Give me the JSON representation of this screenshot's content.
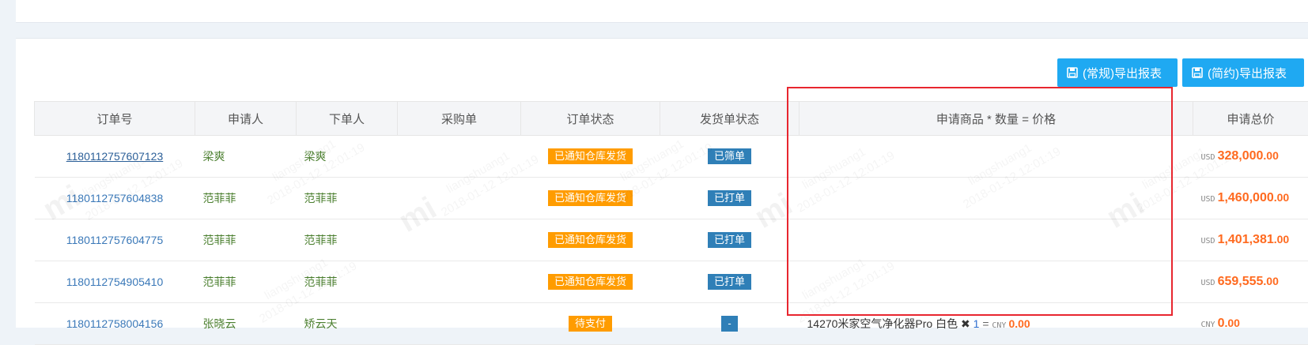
{
  "toolbar": {
    "export_normal_label": "(常规)导出报表",
    "export_simple_label": "(简约)导出报表"
  },
  "table": {
    "headers": [
      "订单号",
      "申请人",
      "下单人",
      "采购单",
      "订单状态",
      "发货单状态",
      "申请商品 * 数量 = 价格",
      "申请总价"
    ],
    "rows": [
      {
        "order_id": "1180112757607123",
        "applicant": "梁爽",
        "orderer": "梁爽",
        "purchase": "",
        "order_status": "已通知仓库发货",
        "ship_status": "已筛单",
        "goods": "",
        "currency": "USD",
        "total_int": "328,000",
        "total_dec": ".00"
      },
      {
        "order_id": "1180112757604838",
        "applicant": "范菲菲",
        "orderer": "范菲菲",
        "purchase": "",
        "order_status": "已通知仓库发货",
        "ship_status": "已打单",
        "goods": "",
        "currency": "USD",
        "total_int": "1,460,000",
        "total_dec": ".00"
      },
      {
        "order_id": "1180112757604775",
        "applicant": "范菲菲",
        "orderer": "范菲菲",
        "purchase": "",
        "order_status": "已通知仓库发货",
        "ship_status": "已打单",
        "goods": "",
        "currency": "USD",
        "total_int": "1,401,381",
        "total_dec": ".00"
      },
      {
        "order_id": "1180112754905410",
        "applicant": "范菲菲",
        "orderer": "范菲菲",
        "purchase": "",
        "order_status": "已通知仓库发货",
        "ship_status": "已打单",
        "goods": "",
        "currency": "USD",
        "total_int": "659,555",
        "total_dec": ".00"
      },
      {
        "order_id": "1180112758004156",
        "applicant": "张晓云",
        "orderer": "矫云天",
        "purchase": "",
        "order_status": "待支付",
        "ship_status": "-",
        "goods_name": "14270米家空气净化器Pro 白色",
        "goods_times": "✖",
        "goods_qty": "1",
        "goods_eq": "=",
        "goods_cur": "CNY",
        "goods_price": "0.00",
        "currency": "CNY",
        "total_int": "0",
        "total_dec": ".00"
      }
    ]
  },
  "watermark": {
    "user": "liangshuang1",
    "date": "2018-01-12 12:01:19",
    "logo": "mi"
  },
  "colors": {
    "button": "#1fa9f2",
    "badge_orange": "#ff9c00",
    "badge_blue": "#2f7fb7",
    "amount": "#ff6a1f",
    "highlight_box": "#e8262f"
  }
}
